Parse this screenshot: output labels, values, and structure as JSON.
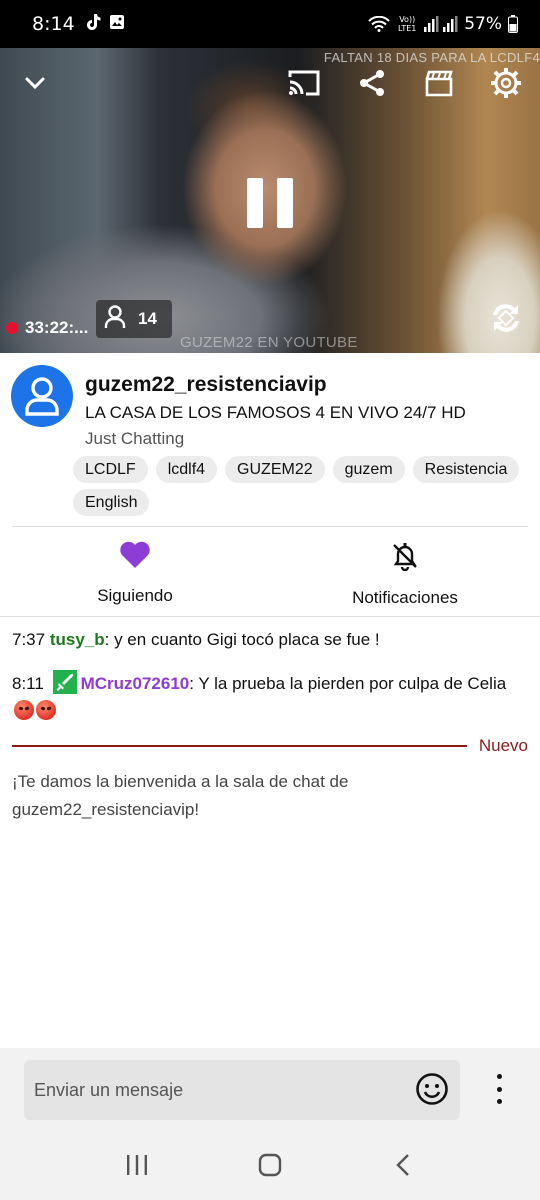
{
  "status_bar": {
    "time": "8:14",
    "network": "Vo)) LTE1",
    "battery": "57%",
    "icons": [
      "tiktok-icon",
      "gallery-icon",
      "wifi-icon",
      "signal-icon",
      "battery-icon"
    ]
  },
  "video": {
    "top_banner": "FALTAN 18 DIAS PARA LA LCDLF4",
    "bottom_banner": "GUZEM22 EN YOUTUBE",
    "uptime": "33:22:...",
    "viewer_count": "14",
    "icons": [
      "chevron-down-icon",
      "cast-icon",
      "share-icon",
      "clip-icon",
      "settings-icon",
      "pause-icon",
      "rotate-icon",
      "person-icon"
    ]
  },
  "channel": {
    "name": "guzem22_resistenciavip",
    "title": "LA CASA DE LOS FAMOSOS 4 EN VIVO 24/7 HD",
    "category": "Just Chatting",
    "tags": [
      "LCDLF",
      "lcdlf4",
      "GUZEM22",
      "guzem",
      "Resistencia",
      "English"
    ]
  },
  "actions": {
    "follow_label": "Siguiendo",
    "notifications_label": "Notificaciones"
  },
  "chat": {
    "messages": [
      {
        "time": "7:37",
        "user": "tusy_b",
        "separator": ":",
        "text": " y en cuanto Gigi tocó placa se fue !"
      },
      {
        "time": "8:11",
        "user": "MCruz072610",
        "separator": ":",
        "text": " Y la prueba la pierden por culpa de Celia"
      }
    ],
    "new_label": "Nuevo",
    "welcome": "¡Te damos la bienvenida a la sala de chat de guzem22_resistenciavip!"
  },
  "input": {
    "placeholder": "Enviar un mensaje"
  },
  "colors": {
    "accent_purple": "#8e3cd6",
    "avatar_blue": "#1c74e8",
    "live_red": "#e8102e",
    "new_separator": "#8b1a1a",
    "user_green": "#1f7a1f"
  }
}
